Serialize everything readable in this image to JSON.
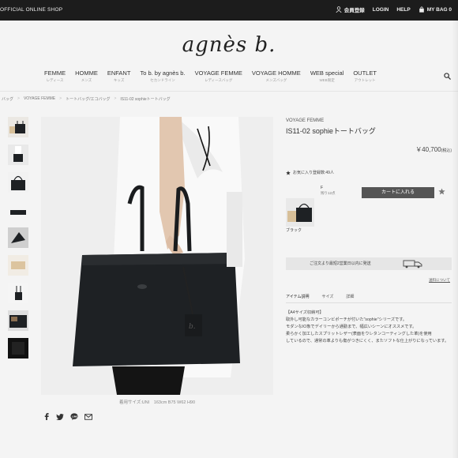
{
  "topbar": {
    "shop_label": "OFFICIAL ONLINE SHOP",
    "nav": [
      {
        "label": "会員登録",
        "icon": "person-icon"
      },
      {
        "label": "LOGIN",
        "icon": ""
      },
      {
        "label": "HELP",
        "icon": ""
      },
      {
        "label": "MY BAG 0",
        "icon": "bag-icon"
      }
    ]
  },
  "logo": "agnès b.",
  "categories": [
    {
      "en": "FEMME",
      "jp": "レディース"
    },
    {
      "en": "HOMME",
      "jp": "メンズ"
    },
    {
      "en": "ENFANT",
      "jp": "キッズ"
    },
    {
      "en": "To b. by agnès b.",
      "jp": "セカンドライン"
    },
    {
      "en": "VOYAGE FEMME",
      "jp": "レディースバッグ"
    },
    {
      "en": "VOYAGE HOMME",
      "jp": "メンズバッグ"
    },
    {
      "en": "WEB special",
      "jp": "WEB限定"
    },
    {
      "en": "OUTLET",
      "jp": "アウトレット"
    }
  ],
  "breadcrumb": [
    "バッグ",
    "VOYAGE FEMME",
    "トートバッグ/エコバッグ",
    "IS11-02 sophieトートバッグ"
  ],
  "caption": "着用サイズ:UNI　163cm B75 W62 H90",
  "product": {
    "brand": "VOYAGE FEMME",
    "name": "IS11-02 sophieトートバッグ",
    "price": "￥40,700",
    "price_tax": "(税込)",
    "favorites": "お気に入り登録数:49人",
    "size": "F",
    "stock": "残り12点",
    "cart_label": "カートに入れる",
    "color": "ブラック",
    "shipping": "ご注文より最短2営業日以内に発送",
    "shipping_details": "送料について",
    "tabs": [
      "アイテム説明",
      "サイズ",
      "詳細"
    ],
    "description": [
      "【A4サイズ収納可】",
      "取外し可能なカラーコンビポーチが付いた\"sophie\"シリーズです。",
      "モダンなIO象でデイリーから通勤まで、幅広いシーンにオススメです。",
      "柔らかく加工したスプリットレザー(表面をウレタンコーティングした革)を使用",
      "しているので、通常の革よりも傷がつきにくく、またソフトな仕上がりになっています。"
    ]
  },
  "colors": {
    "topbar": "#1c1c1c",
    "cart_button": "#555555",
    "bag": "#1e2124"
  }
}
